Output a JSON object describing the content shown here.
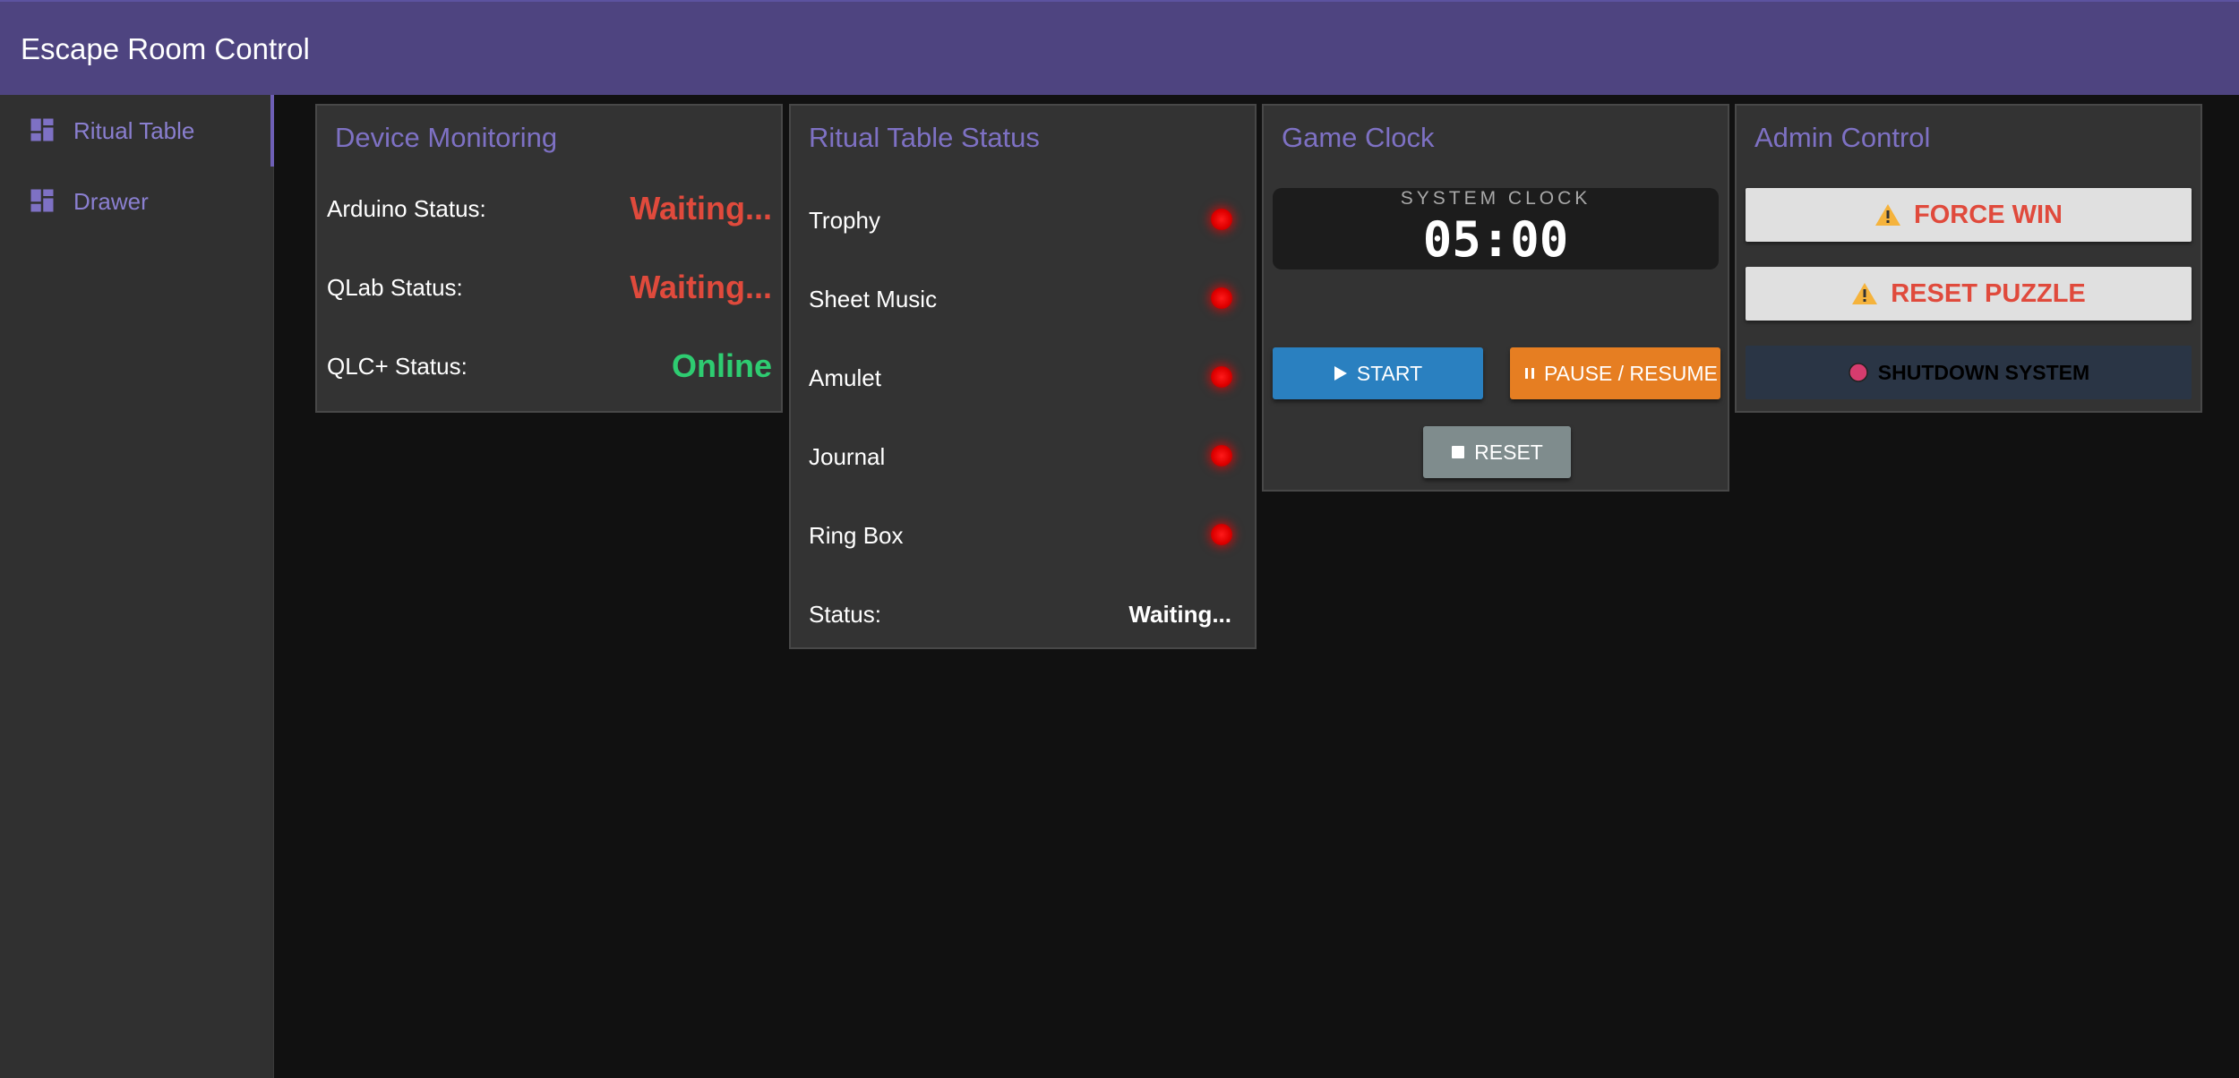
{
  "app": {
    "title": "Escape Room Control"
  },
  "sidebar": {
    "items": [
      {
        "label": "Ritual Table",
        "icon": "dashboard-icon",
        "active": true
      },
      {
        "label": "Drawer",
        "icon": "dashboard-icon",
        "active": false
      }
    ]
  },
  "device_monitoring": {
    "title": "Device Monitoring",
    "rows": [
      {
        "label": "Arduino Status:",
        "value": "Waiting...",
        "color": "#e04a3c"
      },
      {
        "label": "QLab Status:",
        "value": "Waiting...",
        "color": "#e04a3c"
      },
      {
        "label": "QLC+ Status:",
        "value": "Online",
        "color": "#2ecc71"
      }
    ]
  },
  "ritual_table": {
    "title": "Ritual Table Status",
    "items": [
      {
        "label": "Trophy",
        "indicator": "red"
      },
      {
        "label": "Sheet Music",
        "indicator": "red"
      },
      {
        "label": "Amulet",
        "indicator": "red"
      },
      {
        "label": "Journal",
        "indicator": "red"
      },
      {
        "label": "Ring Box",
        "indicator": "red"
      }
    ],
    "status_label": "Status:",
    "status_value": "Waiting..."
  },
  "game_clock": {
    "title": "Game Clock",
    "caption": "SYSTEM CLOCK",
    "time": "05:00",
    "start_label": "START",
    "pause_label": "PAUSE / RESUME",
    "reset_label": "RESET",
    "colors": {
      "start": "#2a80c0",
      "pause": "#e67e22",
      "reset": "#7f8c8d"
    }
  },
  "admin_control": {
    "title": "Admin Control",
    "force_win_label": "FORCE WIN",
    "reset_puzzle_label": "RESET PUZZLE",
    "shutdown_label": "SHUTDOWN SYSTEM",
    "colors": {
      "danger_text": "#e04a3c",
      "shutdown_bg": "#2a3545"
    }
  },
  "theme": {
    "accent": "#4e4480",
    "accent_text": "#7e71c4",
    "panel_bg": "#333333",
    "page_bg": "#111111"
  }
}
